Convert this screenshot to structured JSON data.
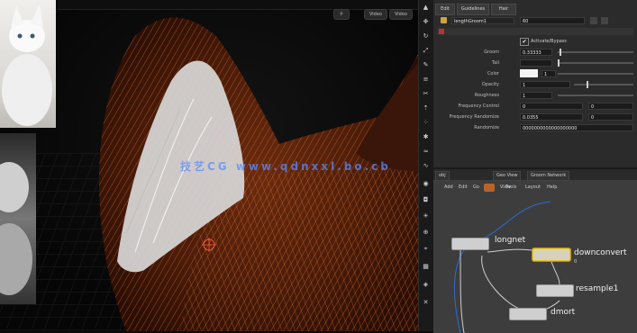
{
  "viewport": {
    "buttons": [
      "⚲",
      "Video",
      "Video"
    ],
    "watermark": "技艺CG  www.qdnxxl.bo.cb"
  },
  "toolbar": {
    "icons": [
      "select",
      "transform",
      "rotate",
      "scale",
      "brush",
      "comb",
      "cut",
      "lift",
      "density",
      "clump",
      "frizz",
      "twist",
      "view",
      "camera",
      "light",
      "snap",
      "pin",
      "grid",
      "render",
      "close"
    ]
  },
  "params": {
    "tabs": [
      "Edit",
      "Guidelines",
      "Hair"
    ],
    "header_field": "lengthGroom1",
    "header_value": "60",
    "checkbox_label": "Activate/Bypass",
    "rows": [
      {
        "label": "Groom",
        "value": "0.33333",
        "slider": true
      },
      {
        "label": "Tail",
        "value": "",
        "slider": true
      },
      {
        "label": "Color",
        "value": "1",
        "swatch": "#f4f4f4"
      },
      {
        "label": "Opacity",
        "value": "1",
        "slider": true
      },
      {
        "label": "Roughness",
        "value": "1",
        "slider": true
      },
      {
        "label": "Frequency Control",
        "value": "0",
        "value2": "0"
      },
      {
        "label": "Frequency Randomize",
        "value": "0.0355",
        "value2": "0"
      },
      {
        "label": "Randomize",
        "value": "0000000000000000000"
      }
    ]
  },
  "network": {
    "tabs": [
      "obj",
      "Geo View",
      "Groom Network"
    ],
    "tools": [
      "Add",
      "Edit",
      "Go",
      "View",
      "Tools",
      "Layout",
      "Help"
    ],
    "nodes": [
      {
        "name": "longnet",
        "sub": ""
      },
      {
        "name": "downconvert",
        "sub": "0"
      },
      {
        "name": "resample1",
        "sub": ""
      },
      {
        "name": "dmort",
        "sub": ""
      }
    ]
  },
  "colors": {
    "fur": "#8a3a12",
    "fur_highlight": "#ff7a1e",
    "selection": "#e5c23a",
    "accent_blue": "#3a6fd8"
  }
}
